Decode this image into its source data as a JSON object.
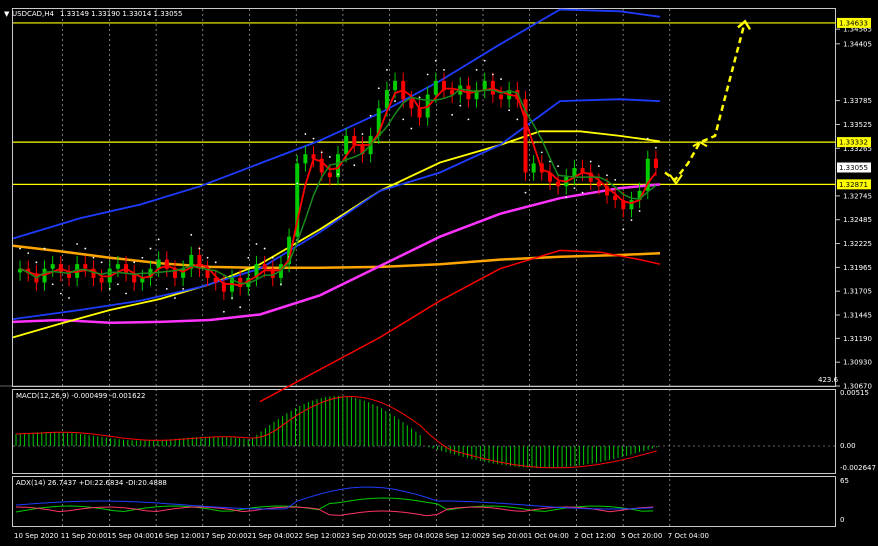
{
  "window": {
    "title": "USDCAD,H4",
    "ohlc": "1.33149 1.33190 1.33014 1.33055"
  },
  "price_axis": {
    "ticks": [
      "1.34565",
      "1.34405",
      "1.33785",
      "1.33525",
      "1.33265",
      "1.32745",
      "1.32485",
      "1.32225",
      "1.31965",
      "1.31705",
      "1.31445",
      "1.31190",
      "1.30930",
      "1.30670"
    ],
    "markers": [
      {
        "text": "1.34633",
        "value": 1.34633,
        "bg": "#ffff00"
      },
      {
        "text": "1.33332",
        "value": 1.33332,
        "bg": "#ffff00"
      },
      {
        "text": "1.33055",
        "value": 1.33055,
        "bg": "#ffffff"
      },
      {
        "text": "1.32871",
        "value": 1.32871,
        "bg": "#ffff00"
      }
    ],
    "level_note": "423.6"
  },
  "macd": {
    "title": "MACD(12,26,9) -0.000499 -0.001622",
    "ticks": [
      "0.00515",
      "0.00",
      "-0.002647"
    ]
  },
  "adx": {
    "title": "ADX(14) 26.7437 +DI:22.6834 -DI:20.4888",
    "ticks": [
      "65",
      "0"
    ]
  },
  "time_axis": [
    "10 Sep 2020",
    "11 Sep 20:00",
    "15 Sep 04:00",
    "16 Sep 12:00",
    "17 Sep 20:00",
    "21 Sep 04:00",
    "22 Sep 12:00",
    "23 Sep 20:00",
    "25 Sep 04:00",
    "28 Sep 12:00",
    "29 Sep 20:00",
    "1 Oct 04:00",
    "2 Oct 12:00",
    "5 Oct 20:00",
    "7 Oct 04:00"
  ],
  "colors": {
    "background": "#000000",
    "bull": "#00cc00",
    "bear": "#ff0000",
    "grid": "#c8c8c8",
    "horizontal_levels": "#ffff00",
    "ma_yellow": "#ffff00",
    "ma_magenta": "#ff33ff",
    "ma_orange": "#ffa500",
    "ma_red": "#ff0000",
    "ma_green": "#00cc00",
    "bollinger": "#1e3cff",
    "macd_hist": "#00cc00",
    "macd_signal": "#ff0000",
    "plus_di": "#00cc00",
    "minus_di": "#ff3366",
    "adx": "#1e3cff",
    "arrow": "#ffff00"
  },
  "chart_data": {
    "type": "line",
    "price_range": [
      1.3067,
      1.34785
    ],
    "horizontal_levels": [
      1.34633,
      1.33332,
      1.32871
    ],
    "close_series": [
      1.3195,
      1.319,
      1.318,
      1.3195,
      1.32,
      1.319,
      1.3185,
      1.32,
      1.3195,
      1.3185,
      1.318,
      1.3195,
      1.32,
      1.319,
      1.318,
      1.3185,
      1.3195,
      1.3205,
      1.3195,
      1.3185,
      1.3195,
      1.321,
      1.3195,
      1.3185,
      1.318,
      1.317,
      1.3185,
      1.3175,
      1.3185,
      1.32,
      1.3195,
      1.3185,
      1.32,
      1.323,
      1.331,
      1.332,
      1.3315,
      1.33,
      1.3295,
      1.332,
      1.334,
      1.333,
      1.332,
      1.334,
      1.337,
      1.339,
      1.34,
      1.338,
      1.337,
      1.336,
      1.3385,
      1.34,
      1.339,
      1.3385,
      1.3395,
      1.338,
      1.339,
      1.34,
      1.3385,
      1.338,
      1.339,
      1.338,
      1.33,
      1.331,
      1.33,
      1.329,
      1.3285,
      1.3295,
      1.3305,
      1.33,
      1.329,
      1.3285,
      1.3275,
      1.327,
      1.326,
      1.327,
      1.328,
      1.3315,
      1.3305
    ]
  }
}
